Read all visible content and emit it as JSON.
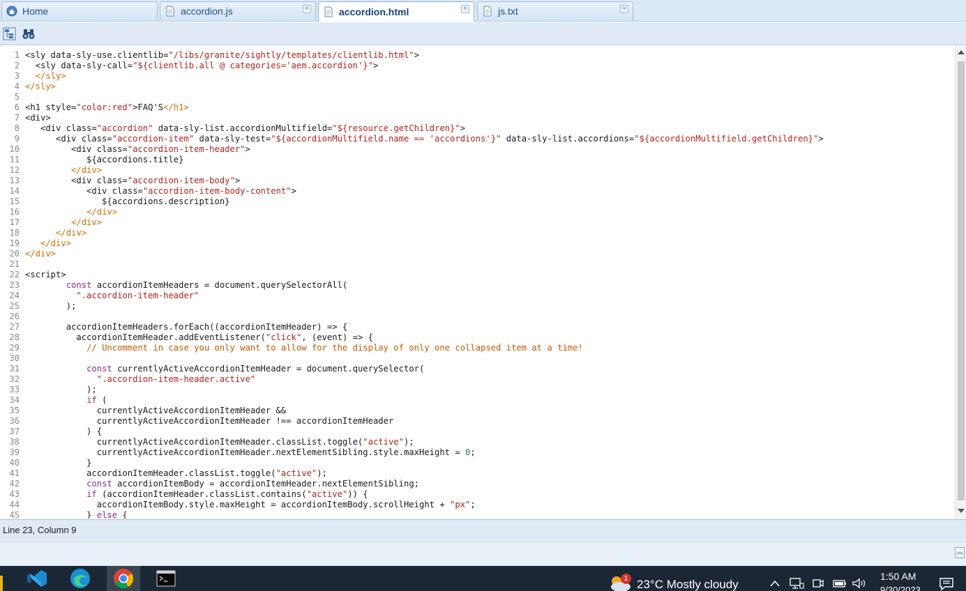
{
  "tabs": [
    {
      "label": "Home",
      "icon": "home-icon",
      "closable": false,
      "active": false
    },
    {
      "label": "accordion.js",
      "icon": "document-icon",
      "closable": true,
      "active": false
    },
    {
      "label": "accordion.html",
      "icon": "document-icon",
      "closable": true,
      "active": true
    },
    {
      "label": "js.txt",
      "icon": "document-icon",
      "closable": true,
      "active": false
    }
  ],
  "toolbar": {
    "buttons": [
      {
        "icon": "hierarchy-icon"
      },
      {
        "icon": "binoculars-find-icon"
      }
    ]
  },
  "editor": {
    "line_numbers": [
      "1",
      "2",
      "3",
      "4",
      "5",
      "6",
      "7",
      "8",
      "9",
      "10",
      "11",
      "12",
      "13",
      "14",
      "15",
      "16",
      "17",
      "18",
      "19",
      "20",
      "21",
      "22",
      "23",
      "24",
      "25",
      "26",
      "27",
      "28",
      "29",
      "30",
      "31",
      "32",
      "33",
      "34",
      "35",
      "36",
      "37",
      "38",
      "39",
      "40",
      "41",
      "42",
      "43",
      "44",
      "45"
    ],
    "lines": [
      "<sly data-sly-use.clientlib=\"/libs/granite/sightly/templates/clientlib.html\">",
      "  <sly data-sly-call=\"${clientlib.all @ categories='aem.accordion'}\">",
      "  </sly>",
      "</sly>",
      "",
      "<h1 style=\"color:red\">FAQ'S</h1>",
      "<div>",
      "   <div class=\"accordion\" data-sly-list.accordionMultifield=\"${resource.getChildren}\">",
      "      <div class=\"accordion-item\" data-sly-test=\"${accordionMultifield.name == 'accordions'}\" data-sly-list.accordions=\"${accordionMultifield.getChildren}\">",
      "         <div class=\"accordion-item-header\">",
      "            ${accordions.title}",
      "         </div>",
      "         <div class=\"accordion-item-body\">",
      "            <div class=\"accordion-item-body-content\">",
      "               ${accordions.description}",
      "            </div>",
      "         </div>",
      "      </div>",
      "   </div>",
      "</div>",
      "",
      "<script>",
      "        const accordionItemHeaders = document.querySelectorAll(",
      "          \".accordion-item-header\"",
      "        );",
      "",
      "        accordionItemHeaders.forEach((accordionItemHeader) => {",
      "          accordionItemHeader.addEventListener(\"click\", (event) => {",
      "            // Uncomment in case you only want to allow for the display of only one collapsed item at a time!",
      "",
      "            const currentlyActiveAccordionItemHeader = document.querySelector(",
      "              \".accordion-item-header.active\"",
      "            );",
      "            if (",
      "              currentlyActiveAccordionItemHeader &&",
      "              currentlyActiveAccordionItemHeader !== accordionItemHeader",
      "            ) {",
      "              currentlyActiveAccordionItemHeader.classList.toggle(\"active\");",
      "              currentlyActiveAccordionItemHeader.nextElementSibling.style.maxHeight = 0;",
      "            }",
      "            accordionItemHeader.classList.toggle(\"active\");",
      "            const accordionItemBody = accordionItemHeader.nextElementSibling;",
      "            if (accordionItemHeader.classList.contains(\"active\")) {",
      "              accordionItemBody.style.maxHeight = accordionItemBody.scrollHeight + \"px\";",
      "            } else {"
    ]
  },
  "status": {
    "cursor": "Line 23, Column 9"
  },
  "taskbar": {
    "apps": [
      {
        "icon": "vscode-icon",
        "active": false
      },
      {
        "icon": "edge-browser-icon",
        "active": false
      },
      {
        "icon": "chrome-browser-icon",
        "active": true
      },
      {
        "icon": "terminal-icon",
        "active": false
      }
    ],
    "weather_badge": "1",
    "weather_text": "23°C  Mostly cloudy",
    "time": "1:50 AM",
    "date": "9/30/2023"
  },
  "colors": {
    "tab_bar": "#dbe8f5",
    "string": "#b0241c",
    "tag_close": "#d46c00",
    "keyword": "#8a2a8a",
    "comment": "#c05a00",
    "number": "#16803c",
    "taskbar": "#1b2734"
  }
}
